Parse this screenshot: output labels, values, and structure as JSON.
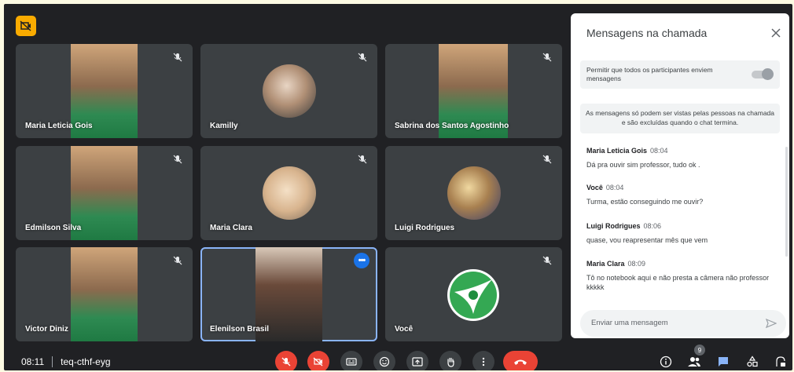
{
  "tiles": [
    {
      "name": "Maria Leticia Gois",
      "kind": "video"
    },
    {
      "name": "Kamilly",
      "kind": "avatar"
    },
    {
      "name": "Sabrina dos Santos Agostinho",
      "kind": "video"
    },
    {
      "name": "Edmilson Silva",
      "kind": "video"
    },
    {
      "name": "Maria Clara",
      "kind": "avatar"
    },
    {
      "name": "Luigi Rodrigues",
      "kind": "avatar"
    },
    {
      "name": "Victor Diniz",
      "kind": "video"
    },
    {
      "name": "Elenilson Brasil",
      "kind": "video",
      "active": true
    },
    {
      "name": "Você",
      "kind": "logo"
    }
  ],
  "chat": {
    "title": "Mensagens na chamada",
    "permission_text": "Permitir que todos os participantes enviem mensagens",
    "info_text": "As mensagens só podem ser vistas pelas pessoas na chamada e são excluídas quando o chat termina.",
    "messages": [
      {
        "author": "Maria Leticia Gois",
        "time": "08:04",
        "text": "Dá pra ouvir sim professor, tudo ok ."
      },
      {
        "author": "Você",
        "time": "08:04",
        "text": "Turma, estão conseguindo me ouvir?"
      },
      {
        "author": "Luigi Rodrigues",
        "time": "08:06",
        "text": "quase, vou reapresentar mês que vem"
      },
      {
        "author": "Maria Clara",
        "time": "08:09",
        "text": "Tô no notebook aqui e não presta a câmera não professor kkkkk"
      }
    ],
    "input_placeholder": "Enviar uma mensagem"
  },
  "meeting": {
    "time": "08:11",
    "code": "teq-cthf-eyg"
  },
  "people_count": "9",
  "colors": {
    "background": "#202124",
    "tile": "#3c4043",
    "danger": "#ea4335",
    "accent": "#1a73e8",
    "badge": "#f9ab00"
  }
}
